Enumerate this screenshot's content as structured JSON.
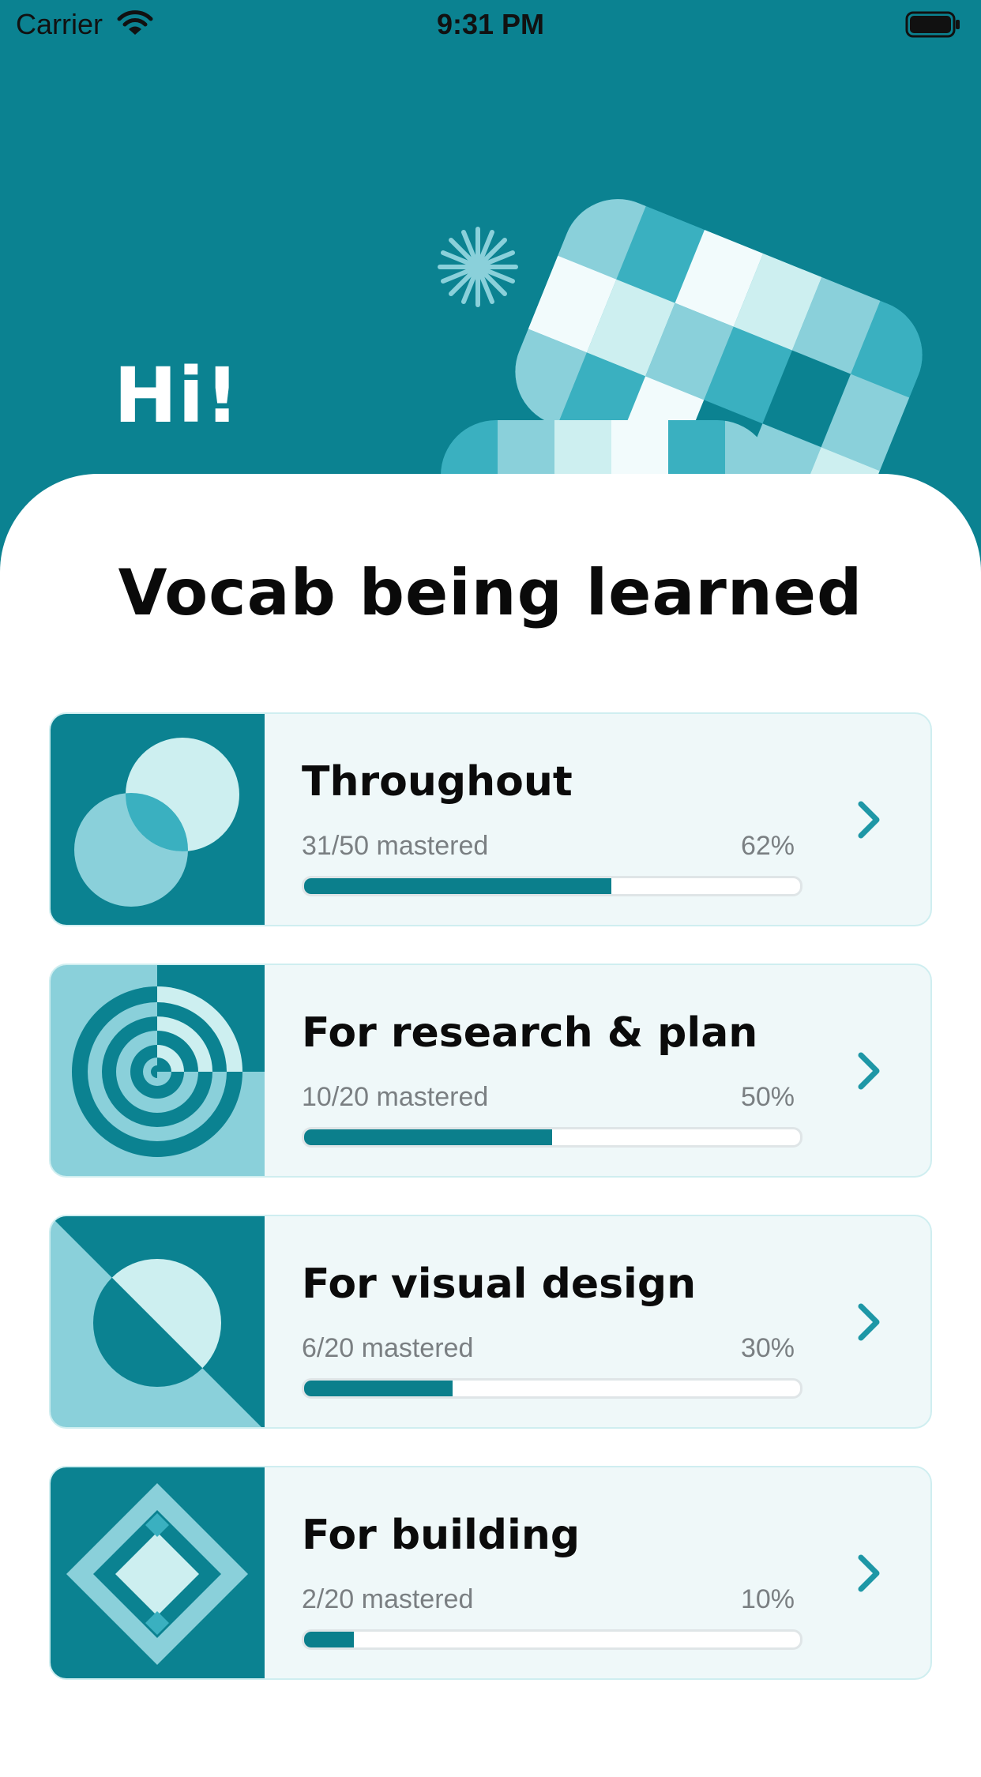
{
  "status_bar": {
    "carrier": "Carrier",
    "time": "9:31 PM"
  },
  "hero": {
    "greeting": "Hi!"
  },
  "section": {
    "title": "Vocab being learned"
  },
  "colors": {
    "primary": "#0b8291",
    "accent_dark": "#0b7f8c",
    "accent_mid": "#3ab0c0",
    "accent_light": "#8ad0da",
    "accent_pale": "#cdeff0",
    "card_bg": "#eff8f9"
  },
  "decks": [
    {
      "title": "Throughout",
      "mastered_text": "31/50 mastered",
      "percent_text": "62%",
      "progress": 0.62,
      "icon": "overlapping-circles-icon"
    },
    {
      "title": "For research & plan",
      "mastered_text": "10/20 mastered",
      "percent_text": "50%",
      "progress": 0.5,
      "icon": "target-rings-icon"
    },
    {
      "title": "For visual design",
      "mastered_text": "6/20 mastered",
      "percent_text": "30%",
      "progress": 0.3,
      "icon": "split-circle-icon"
    },
    {
      "title": "For building",
      "mastered_text": "2/20 mastered",
      "percent_text": "10%",
      "progress": 0.1,
      "icon": "nested-diamonds-icon"
    }
  ]
}
